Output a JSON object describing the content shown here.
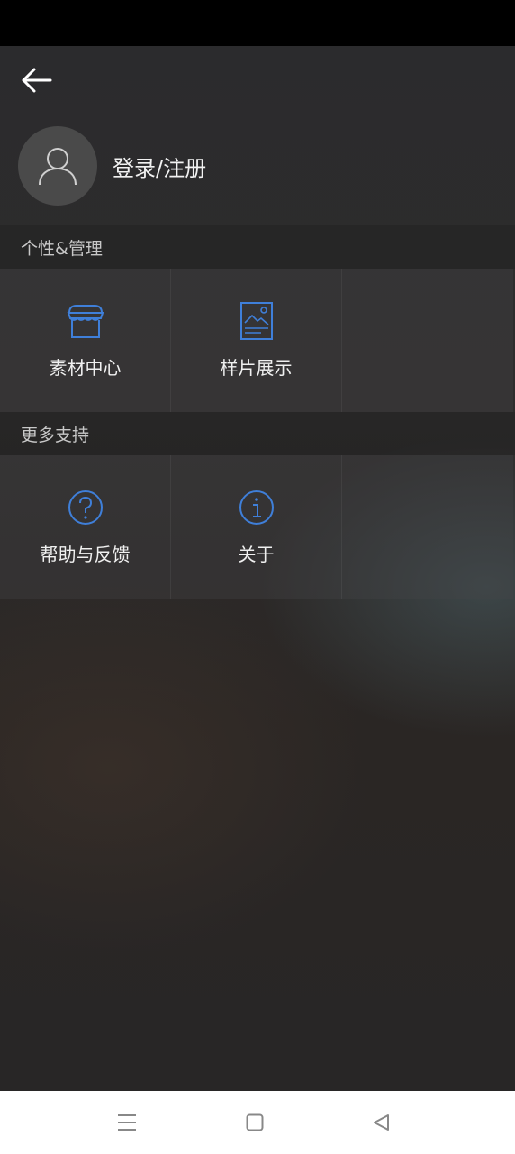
{
  "profile": {
    "login_label": "登录/注册"
  },
  "sections": [
    {
      "title": "个性&管理",
      "items": [
        {
          "label": "素材中心",
          "icon": "store-icon"
        },
        {
          "label": "样片展示",
          "icon": "image-document-icon"
        }
      ]
    },
    {
      "title": "更多支持",
      "items": [
        {
          "label": "帮助与反馈",
          "icon": "help-circle-icon"
        },
        {
          "label": "关于",
          "icon": "info-circle-icon"
        }
      ]
    }
  ],
  "colors": {
    "accent": "#3f7fd9",
    "background": "#2b2b2d"
  },
  "nav": {
    "icons": [
      "menu-icon",
      "home-square-icon",
      "back-triangle-icon"
    ]
  }
}
